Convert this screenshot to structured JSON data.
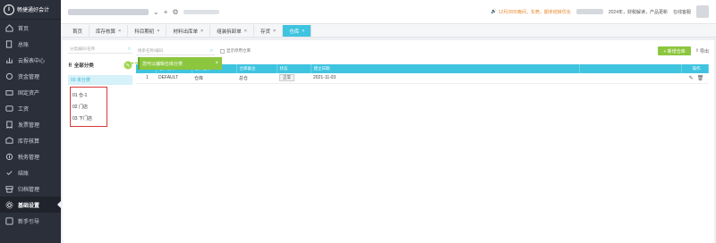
{
  "app": {
    "logo_text": "畅捷通好会计",
    "logo_mark": "i"
  },
  "sidebar": {
    "items": [
      {
        "label": "首页",
        "icon": "home-icon",
        "active": false
      },
      {
        "label": "总账",
        "icon": "ledger-icon",
        "active": false
      },
      {
        "label": "云报表中心",
        "icon": "report-icon",
        "active": false
      },
      {
        "label": "资金管理",
        "icon": "funds-icon",
        "active": false
      },
      {
        "label": "固定资产",
        "icon": "asset-icon",
        "active": false
      },
      {
        "label": "工资",
        "icon": "salary-icon",
        "active": false
      },
      {
        "label": "发票管理",
        "icon": "invoice-icon",
        "active": false
      },
      {
        "label": "库存核算",
        "icon": "inventory-icon",
        "active": false
      },
      {
        "label": "税务管理",
        "icon": "tax-icon",
        "active": false
      },
      {
        "label": "结账",
        "icon": "close-period-icon",
        "active": false
      },
      {
        "label": "归档管理",
        "icon": "archive-icon",
        "active": false
      },
      {
        "label": "基础设置",
        "icon": "settings-icon",
        "active": true
      },
      {
        "label": "新手引导",
        "icon": "guide-icon",
        "active": false
      }
    ]
  },
  "topbar": {
    "notice": "12月28日晚间，东莞，期末结转优化",
    "right_text": "2024年，财税解读，产品更新",
    "online_label": "在线客服"
  },
  "tabs": [
    {
      "label": "首页",
      "closable": false,
      "active": false
    },
    {
      "label": "库存核算",
      "closable": true,
      "active": false
    },
    {
      "label": "科目期初",
      "closable": true,
      "active": false
    },
    {
      "label": "材料出库单",
      "closable": true,
      "active": false
    },
    {
      "label": "组装拆卸单",
      "closable": true,
      "active": false
    },
    {
      "label": "存货",
      "closable": true,
      "active": false
    },
    {
      "label": "仓库",
      "closable": true,
      "active": true
    }
  ],
  "category_panel": {
    "search_placeholder": "分类编码/名称",
    "title": "全部分类",
    "selected_item": "00 未分类",
    "items": [
      "01 仓-1",
      "02 门店",
      "03 下门店"
    ]
  },
  "tooltip": {
    "text": "您可以编辑仓库分类"
  },
  "main": {
    "search_placeholder": "搜索名称/编码",
    "show_disabled_label": "显示停用仓库",
    "add_button_label": "+ 新增仓库",
    "export_label": "导出",
    "columns": [
      "",
      "仓库编码",
      "仓库名称",
      "仓库备注",
      "状态",
      "建立日期",
      "",
      "操作"
    ],
    "rows": [
      {
        "index": "1",
        "code": "DEFAULT",
        "name": "仓库",
        "remark": "总仓",
        "status": "正常",
        "date": "2021-11-03"
      }
    ]
  },
  "colors": {
    "accent": "#3fc4e0",
    "green": "#8cc63f",
    "sidebar_bg": "#2b2f3a",
    "highlight_border": "#d93838"
  }
}
